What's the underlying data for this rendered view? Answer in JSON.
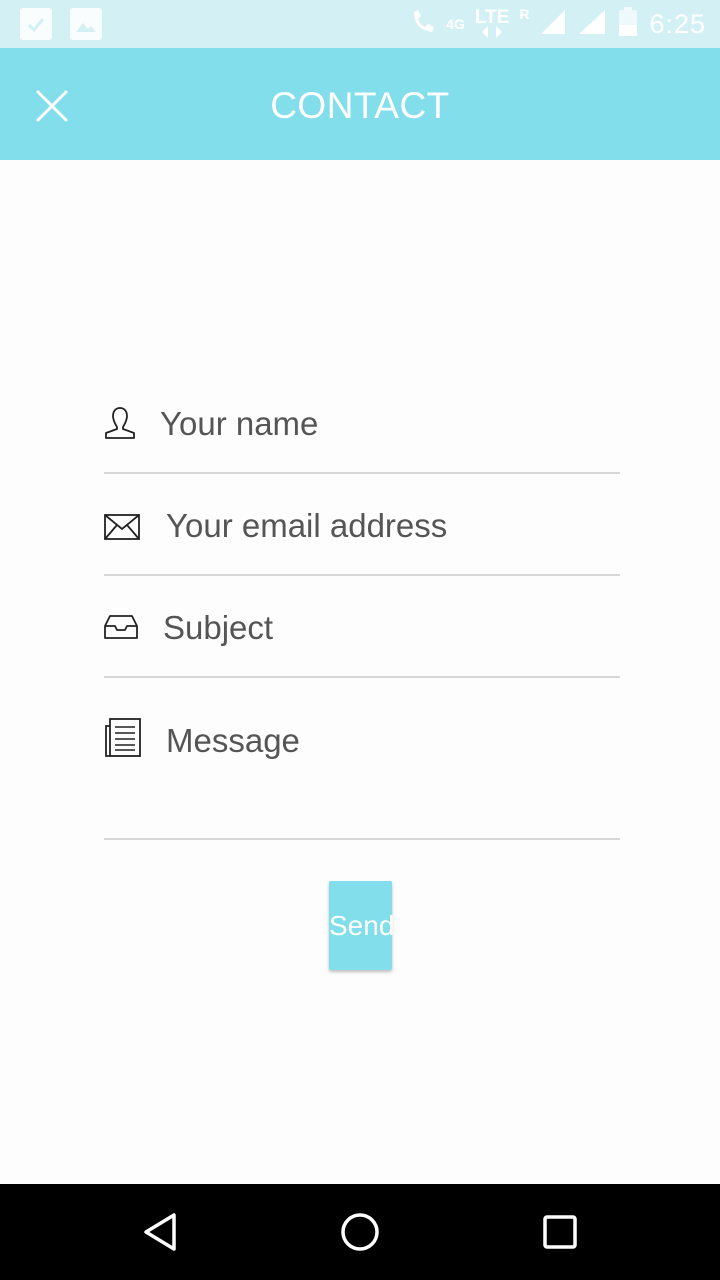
{
  "status_bar": {
    "time": "6:25",
    "network_4g": "4G",
    "network_lte": "LTE",
    "roaming": "R",
    "icons": [
      "checkbox-notification-icon",
      "image-notification-icon",
      "wifi-call-icon",
      "signal-icon",
      "signal-icon",
      "battery-icon"
    ]
  },
  "app_bar": {
    "title": "CONTACT",
    "close_icon": "close-icon",
    "background": "#82deeb"
  },
  "form": {
    "name": {
      "placeholder": "Your name",
      "value": "",
      "icon": "person-icon"
    },
    "email": {
      "placeholder": "Your email address",
      "value": "",
      "icon": "envelope-icon"
    },
    "subject": {
      "placeholder": "Subject",
      "value": "",
      "icon": "inbox-icon"
    },
    "message": {
      "placeholder": "Message",
      "value": "",
      "icon": "document-icon"
    }
  },
  "send_button": {
    "label": "Send",
    "color": "#82deeb"
  },
  "nav_bar": {
    "back": "back-triangle-icon",
    "home": "home-circle-icon",
    "recents": "recents-square-icon"
  }
}
